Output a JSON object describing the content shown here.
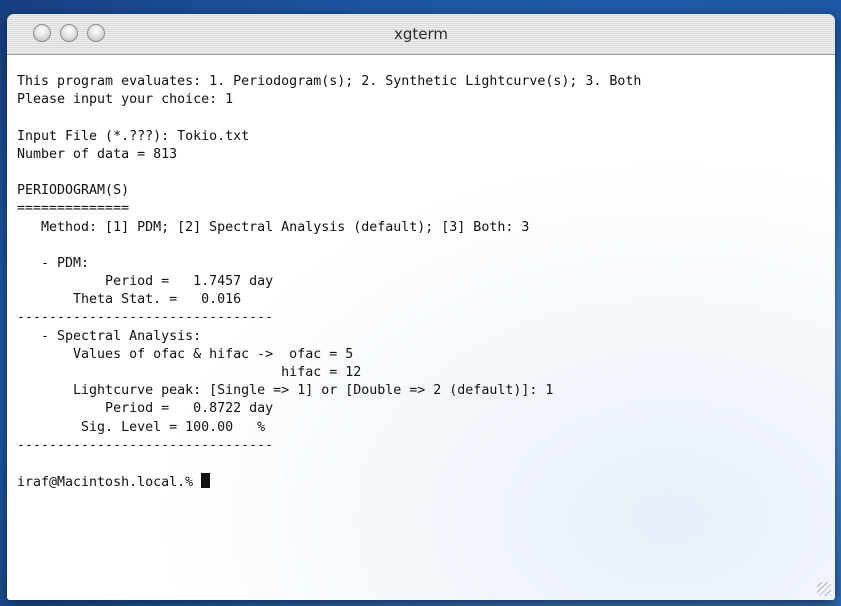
{
  "window": {
    "title": "xgterm"
  },
  "terminal": {
    "lines": [
      "This program evaluates: 1. Periodogram(s); 2. Synthetic Lightcurve(s); 3. Both",
      "Please input your choice: 1",
      "",
      "Input File (*.???): Tokio.txt",
      "Number of data = 813",
      "",
      "PERIODOGRAM(S)",
      "==============",
      "   Method: [1] PDM; [2] Spectral Analysis (default); [3] Both: 3",
      "",
      "   - PDM:",
      "           Period =   1.7457 day",
      "       Theta Stat. =   0.016",
      "--------------------------------",
      "   - Spectral Analysis:",
      "       Values of ofac & hifac ->  ofac = 5",
      "                                 hifac = 12",
      "       Lightcurve peak: [Single => 1] or [Double => 2 (default)]: 1",
      "           Period =   0.8722 day",
      "        Sig. Level = 100.00   %",
      "--------------------------------",
      "",
      "iraf@Macintosh.local.% "
    ]
  }
}
